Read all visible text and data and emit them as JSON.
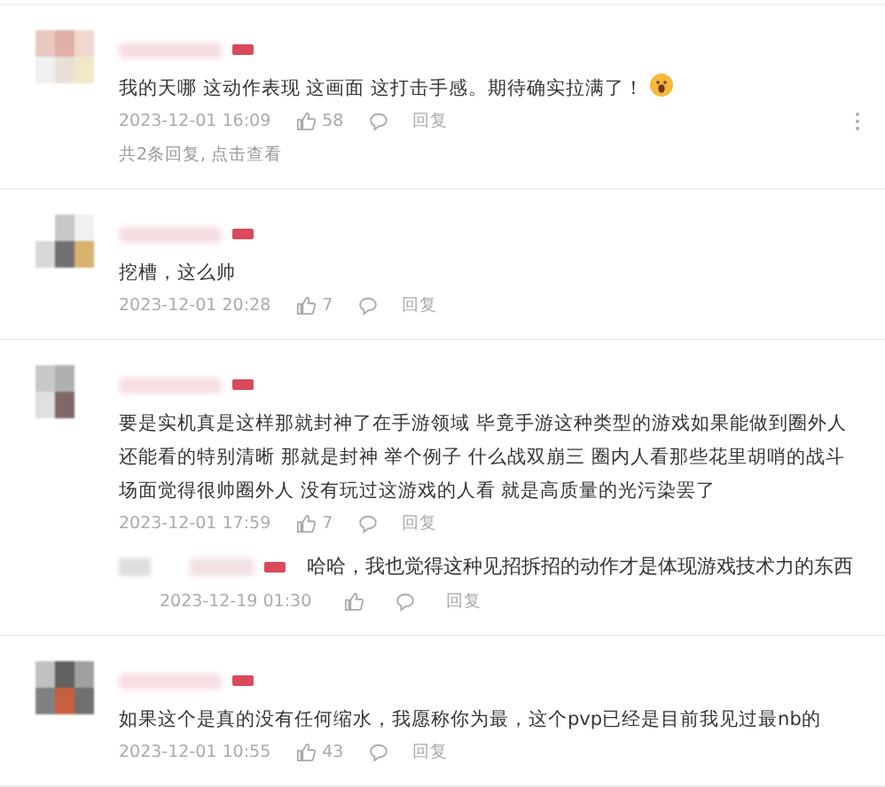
{
  "comments": [
    {
      "text": "我的天哪 这动作表现 这画面 这打击手感。期待确实拉满了！",
      "emoji": true,
      "time": "2023-12-01 16:09",
      "likes": "58",
      "reply_label": "回复",
      "menu": true,
      "more_replies": "共2条回复, 点击查看"
    },
    {
      "text": "挖槽，这么帅",
      "emoji": false,
      "time": "2023-12-01 20:28",
      "likes": "7",
      "reply_label": "回复",
      "menu": false
    },
    {
      "text": "要是实机真是这样那就封神了在手游领域 毕竟手游这种类型的游戏如果能做到圈外人还能看的特别清晰 那就是封神 举个例子 什么战双崩三 圈内人看那些花里胡哨的战斗场面觉得很帅圈外人 没有玩过这游戏的人看 就是高质量的光污染罢了",
      "emoji": false,
      "time": "2023-12-01 17:59",
      "likes": "7",
      "reply_label": "回复",
      "menu": false,
      "replies": [
        {
          "text": "哈哈，我也觉得这种见招拆招的动作才是体现游戏技术力的东西",
          "time": "2023-12-19 01:30",
          "reply_label": "回复"
        }
      ]
    },
    {
      "text": "如果这个是真的没有任何缩水，我愿称你为最，这个pvp已经是目前我见过最nb的",
      "emoji": false,
      "time": "2023-12-01 10:55",
      "likes": "43",
      "reply_label": "回复",
      "menu": false
    }
  ]
}
